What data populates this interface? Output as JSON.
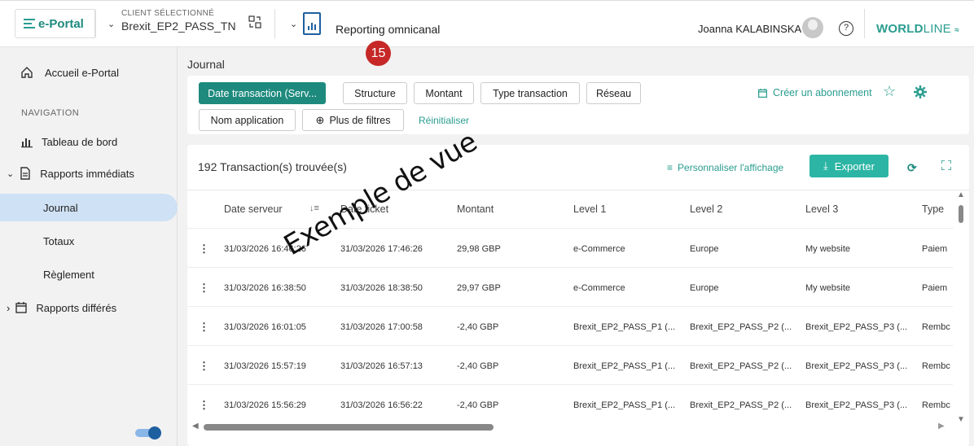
{
  "topbar": {
    "app_name": "e-Portal",
    "client_label": "CLIENT SÉLECTIONNÉ",
    "client_value": "Brexit_EP2_PASS_TN",
    "report_title": "Reporting omnicanal",
    "step_badge": "15",
    "user_name": "Joanna KALABINSKA",
    "help_glyph": "?",
    "brand_bold": "WORLD",
    "brand_light": "LINE"
  },
  "sidebar": {
    "home": "Accueil e-Portal",
    "nav_label": "NAVIGATION",
    "items": [
      {
        "label": "Tableau de bord"
      },
      {
        "label": "Rapports immédiats"
      },
      {
        "label": "Journal"
      },
      {
        "label": "Totaux"
      },
      {
        "label": "Règlement"
      },
      {
        "label": "Rapports différés"
      }
    ]
  },
  "main": {
    "title": "Journal",
    "filters": {
      "chips": [
        "Date transaction (Serv...",
        "Structure",
        "Montant",
        "Type transaction",
        "Réseau",
        "Nom application",
        "Plus de filtres"
      ],
      "reset": "Réinitialiser",
      "subscribe": "Créer un abonnement"
    },
    "table": {
      "count": "192 Transaction(s) trouvée(s)",
      "personalize": "Personnaliser l'affichage",
      "export": "Exporter",
      "columns": [
        "Date serveur",
        "Date ticket",
        "Montant",
        "Level 1",
        "Level 2",
        "Level 3",
        "Type"
      ],
      "rows": [
        [
          "31/03/2026 16:46:26",
          "31/03/2026 17:46:26",
          "29,98 GBP",
          "e-Commerce",
          "Europe",
          "My website",
          "Paiem"
        ],
        [
          "31/03/2026 16:38:50",
          "31/03/2026 18:38:50",
          "29,97 GBP",
          "e-Commerce",
          "Europe",
          "My website",
          "Paiem"
        ],
        [
          "31/03/2026 16:01:05",
          "31/03/2026 17:00:58",
          "-2,40 GBP",
          "Brexit_EP2_PASS_P1 (...",
          "Brexit_EP2_PASS_P2 (...",
          "Brexit_EP2_PASS_P3 (...",
          "Rembc"
        ],
        [
          "31/03/2026 15:57:19",
          "31/03/2026 16:57:13",
          "-2,40 GBP",
          "Brexit_EP2_PASS_P1 (...",
          "Brexit_EP2_PASS_P2 (...",
          "Brexit_EP2_PASS_P3 (...",
          "Rembc"
        ],
        [
          "31/03/2026 15:56:29",
          "31/03/2026 16:56:22",
          "-2,40 GBP",
          "Brexit_EP2_PASS_P1 (...",
          "Brexit_EP2_PASS_P2 (...",
          "Brexit_EP2_PASS_P3 (...",
          "Rembc"
        ]
      ]
    }
  },
  "watermark": "Exemple de vue",
  "colors": {
    "accent": "#1e8a7e",
    "link": "#2a9d8f",
    "badge": "#c62828",
    "active_nav": "#cfe1f4"
  }
}
